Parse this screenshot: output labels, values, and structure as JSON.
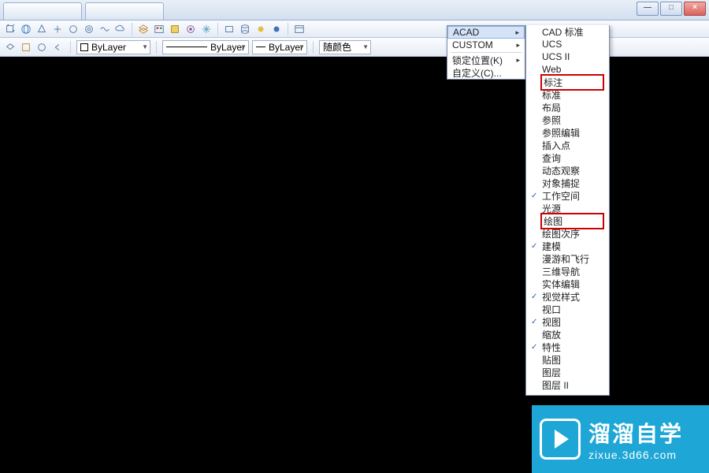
{
  "window": {
    "min": "—",
    "max": "□",
    "close": "×"
  },
  "tabs": [
    "",
    ""
  ],
  "toolbar1_icons": [
    "cube",
    "globe",
    "cone",
    "plus",
    "sphere",
    "donut",
    "warp",
    "cloud",
    "layers",
    "palette",
    "highlight",
    "isolate",
    "freeze",
    "box",
    "cylinder",
    "dot-y",
    "dot-b",
    "recent"
  ],
  "toolbar2": {
    "layer_label": "ByLayer",
    "line_label": "ByLayer",
    "wt_label": "ByLayer",
    "color_label": "随颜色"
  },
  "menu1": {
    "items": [
      {
        "label": "ACAD",
        "submenu": true,
        "hl": true
      },
      {
        "label": "CUSTOM",
        "submenu": true
      },
      {
        "label": "锁定位置(K)",
        "submenu": true
      },
      {
        "label": "自定义(C)...",
        "submenu": false
      }
    ]
  },
  "menu2": {
    "items": [
      {
        "label": "CAD 标准"
      },
      {
        "label": "UCS"
      },
      {
        "label": "UCS II"
      },
      {
        "label": "Web"
      },
      {
        "label": "标注",
        "red": true
      },
      {
        "label": "标准"
      },
      {
        "label": "布局"
      },
      {
        "label": "参照"
      },
      {
        "label": "参照编辑"
      },
      {
        "label": "插入点"
      },
      {
        "label": "查询"
      },
      {
        "label": "动态观察"
      },
      {
        "label": "对象捕捉"
      },
      {
        "label": "工作空间",
        "checked": true
      },
      {
        "label": "光源"
      },
      {
        "label": "绘图",
        "red": true
      },
      {
        "label": "绘图次序"
      },
      {
        "label": "建模",
        "checked": true
      },
      {
        "label": "漫游和飞行"
      },
      {
        "label": "三维导航"
      },
      {
        "label": "实体编辑"
      },
      {
        "label": "视觉样式",
        "checked": true
      },
      {
        "label": "视口"
      },
      {
        "label": "视图",
        "checked": true
      },
      {
        "label": "缩放"
      },
      {
        "label": "特性",
        "checked": true
      },
      {
        "label": "贴图"
      },
      {
        "label": "图层"
      },
      {
        "label": "图层 II"
      }
    ]
  },
  "watermark": {
    "title": "溜溜自学",
    "url": "zixue.3d66.com"
  }
}
